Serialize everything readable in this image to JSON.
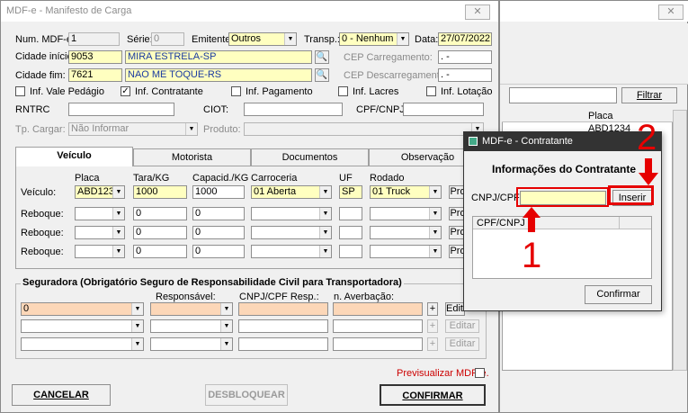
{
  "main": {
    "title": "MDF-e - Manifesto de Carga",
    "close": "✕",
    "num_label": "Num. MDF-e:",
    "num_value": "1",
    "serie_label": "Série:",
    "serie_value": "0",
    "emitente_label": "Emitente:",
    "emitente_value": "Outros",
    "transp_label": "Transp.:",
    "transp_value": "0 - Nenhum",
    "data_label": "Data:",
    "data_value": "27/07/2022",
    "cidade_inicio_label": "Cidade início:",
    "cidade_inicio_code": "9053",
    "cidade_inicio_name": "MIRA ESTRELA-SP",
    "cidade_fim_label": "Cidade fim:",
    "cidade_fim_code": "7621",
    "cidade_fim_name": "NAO ME TOQUE-RS",
    "cep_carreg_label": "CEP Carregamento:",
    "cep_carreg_value": ".  -",
    "cep_descarreg_label": "CEP Descarregamento:",
    "cep_descarreg_value": ".  -",
    "checks": [
      {
        "label": "Inf. Vale Pedágio",
        "checked": ""
      },
      {
        "label": "Inf. Contratante",
        "checked": "✓"
      },
      {
        "label": "Inf. Pagamento",
        "checked": ""
      },
      {
        "label": "Inf. Lacres",
        "checked": ""
      },
      {
        "label": "Inf. Lotação",
        "checked": ""
      }
    ],
    "rntrc_label": "RNTRC",
    "ciot_label": "CIOT:",
    "cpf_cnpj_label": "CPF/CNPJ:",
    "tp_cargar_label": "Tp. Cargar:",
    "tp_cargar_value": "Não Informar",
    "produto_label": "Produto:",
    "tabs": [
      "Veículo",
      "Motorista",
      "Documentos",
      "Observação"
    ],
    "veiculo": {
      "headers": [
        "Placa",
        "Tara/KG",
        "Capacid./KG",
        "Carroceria",
        "UF",
        "Rodado"
      ],
      "row_label": "Veículo:",
      "placa": "ABD1234",
      "tara": "1000",
      "capacid": "1000",
      "carroceria": "01 Aberta",
      "uf": "SP",
      "rodado": "01 Truck",
      "pro": "Pro",
      "reboque_label": "Reboque:",
      "zero": "0"
    },
    "seguradora": {
      "title": "Seguradora (Obrigatório Seguro de Responsabilidade Civil para Transportadora)",
      "responsavel": "Responsável:",
      "cnpj_resp": "CNPJ/CPF Resp.:",
      "averbacao": "n. Averbação:",
      "first_value": "0",
      "plus": "+",
      "editar": "Editar"
    },
    "previsualizar": "Previsualizar MDF-e.",
    "cancelar": "CANCELAR",
    "desbloquear": "DESBLOQUEAR",
    "confirmar": "CONFIRMAR"
  },
  "back": {
    "filtrar": "Filtrar",
    "placa_header": "Placa",
    "placa_value": "ABD1234"
  },
  "dialog": {
    "title": "MDF-e - Contratante",
    "heading": "Informações do Contratante",
    "cnpj_label": "CNPJ/CPF:",
    "inserir": "Inserir",
    "list_header": "CPF/CNPJ",
    "confirmar": "Confirmar"
  },
  "annotations": {
    "n1": "1",
    "n2": "2",
    "arrow_color": "#e60000"
  }
}
